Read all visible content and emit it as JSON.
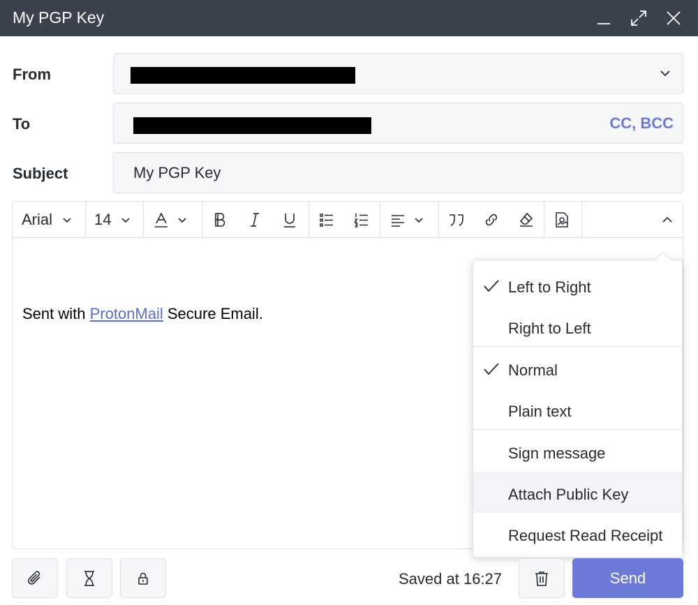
{
  "window": {
    "title": "My PGP Key",
    "controls": [
      "minimize-icon",
      "expand-icon",
      "close-icon"
    ]
  },
  "form": {
    "from_label": "From",
    "to_label": "To",
    "subject_label": "Subject",
    "from_value_redacted": true,
    "to_value_redacted": true,
    "cc_bcc_label": "CC, BCC",
    "subject_value": "My PGP Key"
  },
  "toolbar": {
    "font_family": "Arial",
    "font_size": "14",
    "buttons": [
      "text-color-icon",
      "bold-icon",
      "italic-icon",
      "underline-icon",
      "unordered-list-icon",
      "ordered-list-icon",
      "align-left-icon",
      "quote-icon",
      "link-icon",
      "clear-formatting-icon",
      "insert-image-icon",
      "collapse-more-icon"
    ]
  },
  "editor": {
    "body_prefix": "Sent with ",
    "body_link": "ProtonMail",
    "body_suffix": " Secure Email."
  },
  "menu": {
    "items": [
      {
        "label": "Left to Right",
        "checked": true
      },
      {
        "label": "Right to Left",
        "checked": false
      },
      {
        "label": "Normal",
        "checked": true
      },
      {
        "label": "Plain text",
        "checked": false
      },
      {
        "label": "Sign message",
        "checked": false
      },
      {
        "label": "Attach Public Key",
        "checked": false
      },
      {
        "label": "Request Read Receipt",
        "checked": false
      }
    ]
  },
  "footer": {
    "saved_text": "Saved at 16:27",
    "send_label": "Send",
    "buttons": [
      "paperclip-icon",
      "hourglass-icon",
      "lock-icon",
      "trash-icon"
    ]
  },
  "colors": {
    "titlebar": "#3c414e",
    "accent": "#6d7ad8",
    "link": "#5b6ec8"
  }
}
